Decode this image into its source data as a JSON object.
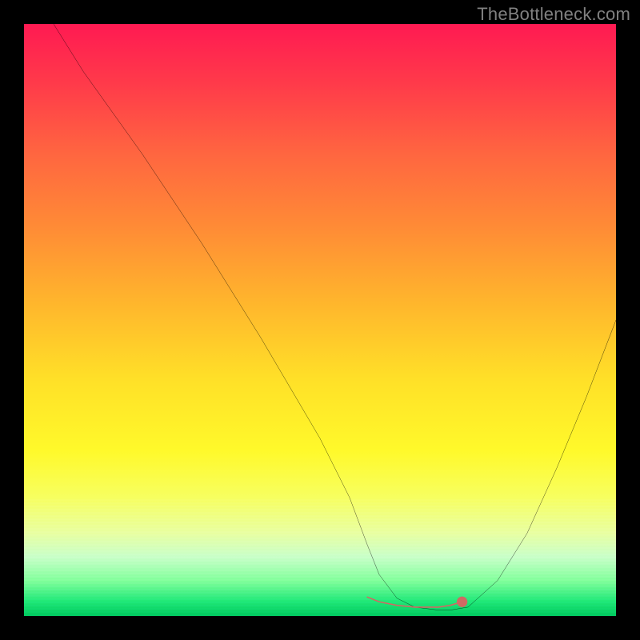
{
  "watermark": "TheBottleneck.com",
  "chart_data": {
    "type": "line",
    "title": "",
    "xlabel": "",
    "ylabel": "",
    "xlim": [
      0,
      100
    ],
    "ylim": [
      0,
      100
    ],
    "grid": false,
    "series": [
      {
        "name": "bottleneck-curve",
        "color": "#000000",
        "x": [
          5,
          10,
          20,
          30,
          40,
          50,
          55,
          58,
          60,
          63,
          66,
          70,
          72,
          75,
          80,
          85,
          90,
          95,
          100
        ],
        "y": [
          100,
          92,
          78,
          63,
          47,
          30,
          20,
          12,
          7,
          3,
          1.5,
          1,
          1,
          1.5,
          6,
          14,
          25,
          37,
          50
        ]
      },
      {
        "name": "optimal-range-marker",
        "color": "#cf6a63",
        "x": [
          58,
          60,
          63,
          66,
          70,
          72,
          74
        ],
        "y": [
          3.2,
          2.4,
          1.8,
          1.5,
          1.5,
          1.8,
          2.4
        ]
      }
    ],
    "annotations": [
      {
        "name": "marker-dot",
        "x": 74,
        "y": 2.4,
        "color": "#cf6a63"
      }
    ],
    "background_gradient_stops": [
      {
        "pct": 0,
        "color": "#ff1a52"
      },
      {
        "pct": 60,
        "color": "#ffe028"
      },
      {
        "pct": 80,
        "color": "#f7ff60"
      },
      {
        "pct": 100,
        "color": "#00c85c"
      }
    ]
  }
}
